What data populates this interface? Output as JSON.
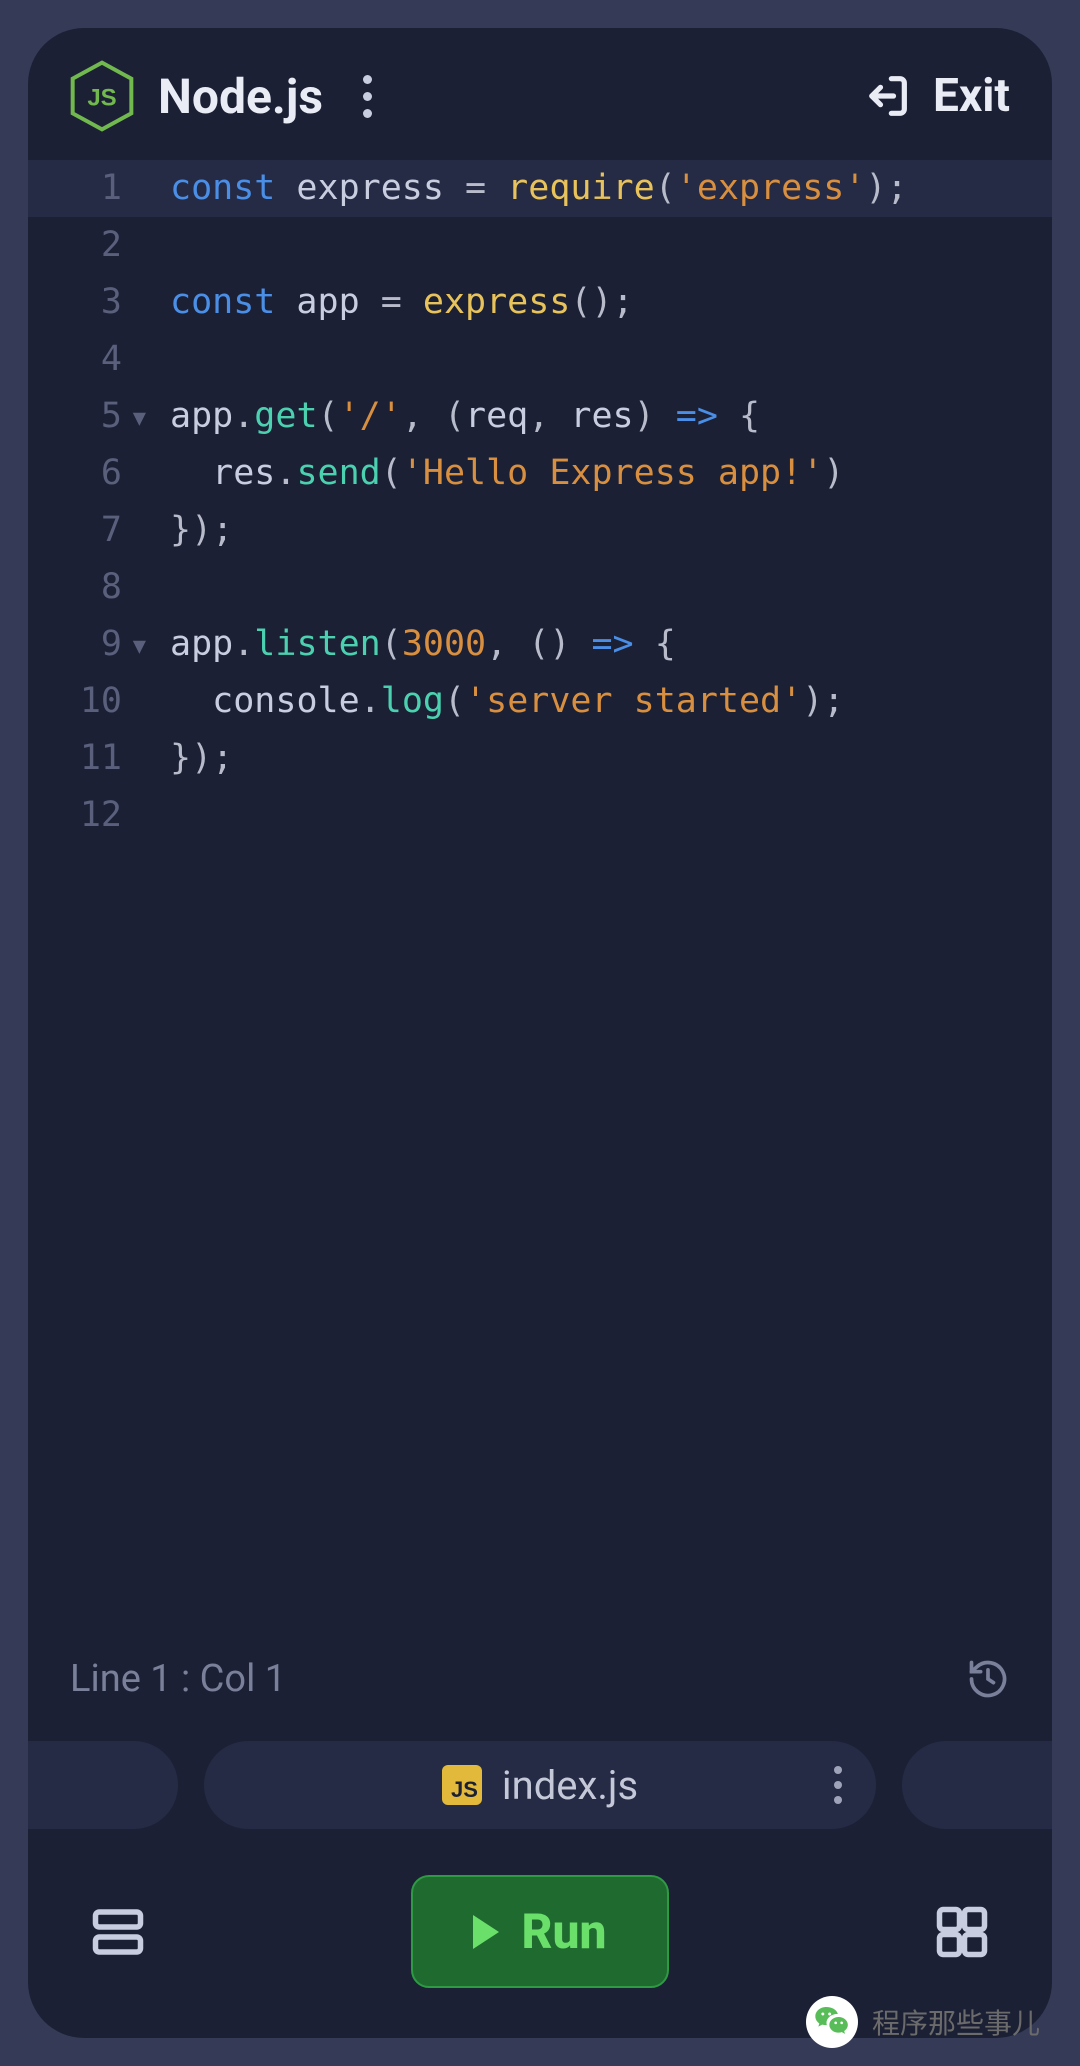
{
  "header": {
    "title": "Node.js",
    "exit_label": "Exit"
  },
  "editor": {
    "lines": [
      1,
      2,
      3,
      4,
      5,
      6,
      7,
      8,
      9,
      10,
      11,
      12
    ],
    "fold_lines": [
      5,
      9
    ],
    "code": [
      {
        "hl": true,
        "tokens": [
          [
            "kw",
            "const"
          ],
          [
            "id",
            " express "
          ],
          [
            "punc",
            "= "
          ],
          [
            "call",
            "require"
          ],
          [
            "punc",
            "("
          ],
          [
            "str",
            "'express'"
          ],
          [
            "punc",
            ");"
          ]
        ]
      },
      {
        "tokens": []
      },
      {
        "tokens": [
          [
            "kw",
            "const"
          ],
          [
            "id",
            " app "
          ],
          [
            "punc",
            "= "
          ],
          [
            "call",
            "express"
          ],
          [
            "punc",
            "();"
          ]
        ]
      },
      {
        "tokens": []
      },
      {
        "tokens": [
          [
            "id",
            "app"
          ],
          [
            "punc",
            "."
          ],
          [
            "fn",
            "get"
          ],
          [
            "punc",
            "("
          ],
          [
            "str",
            "'/'"
          ],
          [
            "punc",
            ", ("
          ],
          [
            "id",
            "req"
          ],
          [
            "punc",
            ", "
          ],
          [
            "id",
            "res"
          ],
          [
            "punc",
            ") "
          ],
          [
            "kw",
            "=>"
          ],
          [
            "punc",
            " {"
          ]
        ]
      },
      {
        "tokens": [
          [
            "punc",
            "  "
          ],
          [
            "id",
            "res"
          ],
          [
            "punc",
            "."
          ],
          [
            "fn",
            "send"
          ],
          [
            "punc",
            "("
          ],
          [
            "str",
            "'Hello Express app!'"
          ],
          [
            "punc",
            ")"
          ]
        ]
      },
      {
        "tokens": [
          [
            "punc",
            "});"
          ]
        ]
      },
      {
        "tokens": []
      },
      {
        "tokens": [
          [
            "id",
            "app"
          ],
          [
            "punc",
            "."
          ],
          [
            "fn",
            "listen"
          ],
          [
            "punc",
            "("
          ],
          [
            "num",
            "3000"
          ],
          [
            "punc",
            ", () "
          ],
          [
            "kw",
            "=>"
          ],
          [
            "punc",
            " {"
          ]
        ]
      },
      {
        "tokens": [
          [
            "punc",
            "  "
          ],
          [
            "id",
            "console"
          ],
          [
            "punc",
            "."
          ],
          [
            "fn",
            "log"
          ],
          [
            "punc",
            "("
          ],
          [
            "str",
            "'server started'"
          ],
          [
            "punc",
            ");"
          ]
        ]
      },
      {
        "tokens": [
          [
            "punc",
            "});"
          ]
        ]
      },
      {
        "tokens": []
      }
    ]
  },
  "status": {
    "cursor": "Line 1 : Col 1"
  },
  "tab": {
    "filename": "index.js",
    "badge": "JS"
  },
  "bottom": {
    "run_label": "Run"
  },
  "watermark": {
    "text": "程序那些事儿"
  }
}
